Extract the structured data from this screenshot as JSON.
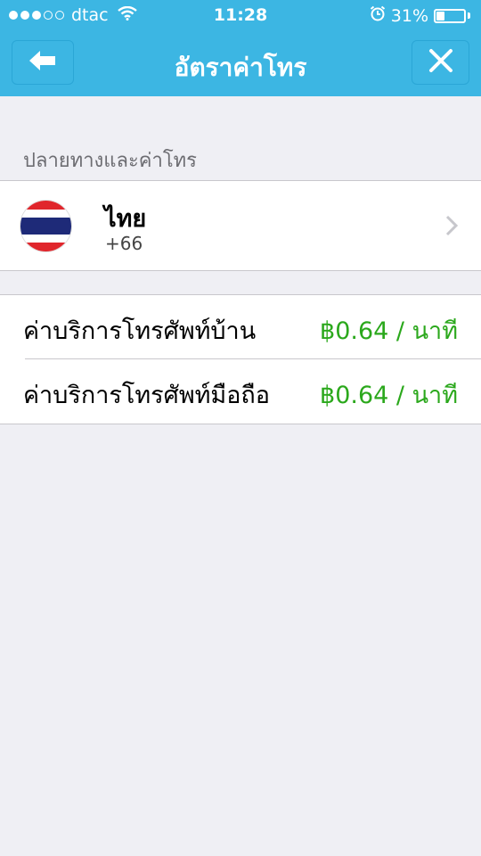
{
  "status_bar": {
    "carrier": "dtac",
    "time": "11:28",
    "battery": "31%",
    "battery_level": 0.31,
    "signal_bars": 3,
    "signal_max": 5
  },
  "nav": {
    "title": "อัตราค่าโทร",
    "back_icon": "back-arrow-icon",
    "close_icon": "close-icon",
    "color": "#3cb6e3"
  },
  "section": {
    "header": "ปลายทางและค่าโทร"
  },
  "country": {
    "name": "ไทย",
    "code": "+66",
    "flag_icon": "thailand-flag-icon"
  },
  "rates": [
    {
      "label": "ค่าบริการโทรศัพท์บ้าน",
      "value": "฿0.64 / นาที"
    },
    {
      "label": "ค่าบริการโทรศัพท์มือถือ",
      "value": "฿0.64 / นาที"
    }
  ],
  "colors": {
    "rate_green": "#2ba81c",
    "background": "#efeff4"
  }
}
